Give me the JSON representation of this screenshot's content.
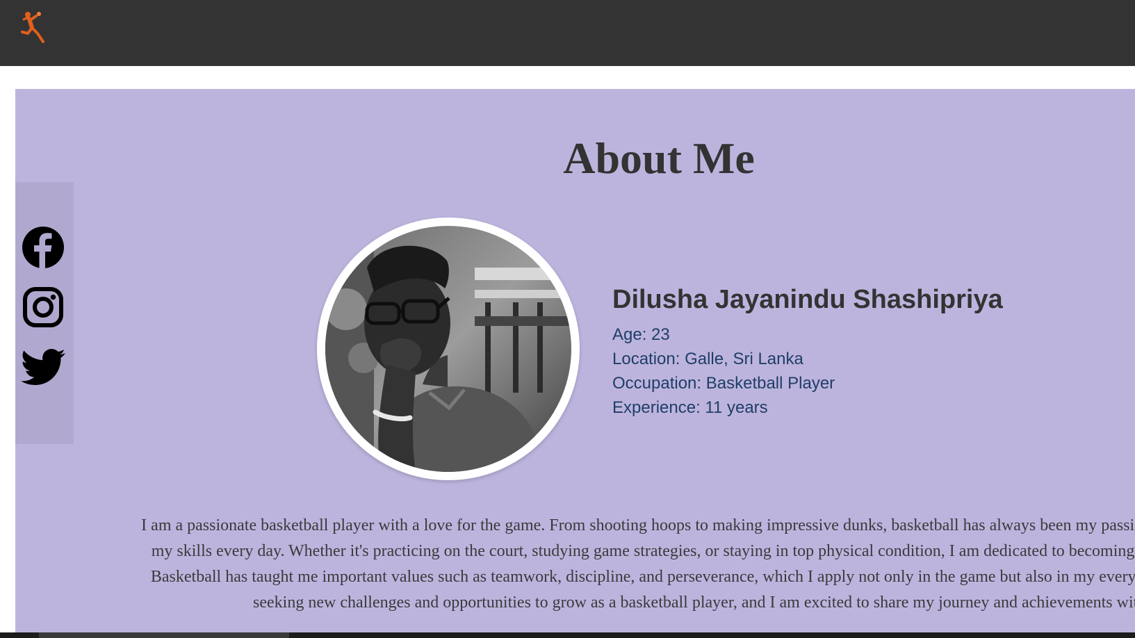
{
  "header": {
    "logo_icon": "basketball-player-logo-icon",
    "background_color": "#333333",
    "logo_color": "#e0601c"
  },
  "about": {
    "background_color": "#bdb4de",
    "title": "About Me",
    "name": "Dilusha Jayanindu Shashipriya",
    "details": [
      "Age: 23",
      "Location: Galle, Sri Lanka",
      "Occupation: Basketball Player",
      "Experience: 11 years"
    ],
    "bio": "I am a passionate basketball player with a love for the game. From shooting hoops to making impressive dunks, basketball has always been my passion and I strive to improve my skills every day. Whether it's practicing on the court, studying game strategies, or staying in top physical condition, I am dedicated to becoming the best player I can be. Basketball has taught me important values such as teamwork, discipline, and perseverance, which I apply not only in the game but also in my everyday life. I am constantly seeking new challenges and opportunities to grow as a basketball player, and I am excited to share my journey and achievements with others."
  },
  "social": {
    "background_color": "#b1a8cf",
    "links": [
      {
        "icon": "facebook-icon"
      },
      {
        "icon": "instagram-icon"
      },
      {
        "icon": "twitter-icon"
      }
    ]
  }
}
